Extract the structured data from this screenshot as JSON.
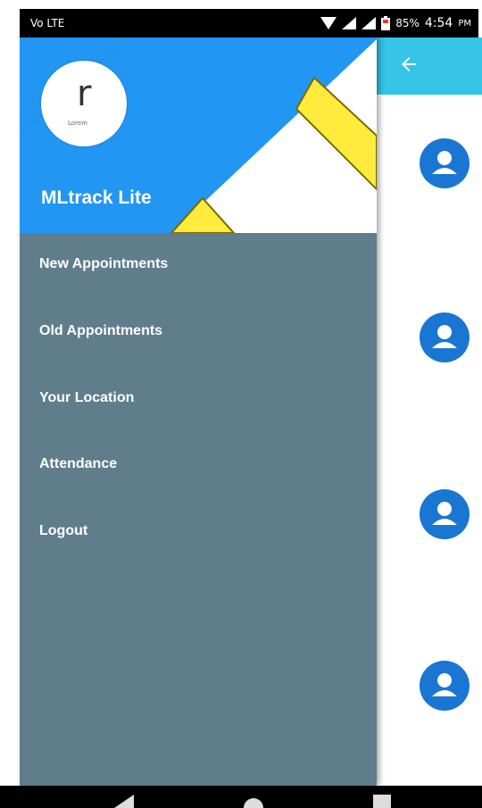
{
  "status_bar": {
    "left_text": "Vo LTE",
    "battery_percent": "85%",
    "time": "4:54",
    "ampm": "PM"
  },
  "drawer": {
    "logo_letter": "r",
    "logo_caption": "Lorem",
    "app_name": "MLtrack Lite",
    "menu_items": [
      {
        "label": "New Appointments"
      },
      {
        "label": "Old Appointments"
      },
      {
        "label": "Your Location"
      },
      {
        "label": "Attendance"
      },
      {
        "label": "Logout"
      }
    ]
  },
  "colors": {
    "drawer_bg": "#607d8b",
    "header_blue": "#2196f3",
    "header_yellow": "#ffeb3b",
    "appbar": "#35c3e8",
    "avatar": "#1976d2"
  },
  "icons": {
    "back": "arrow-left-icon",
    "avatar": "person-icon",
    "nav_back": "triangle-back-icon",
    "nav_home": "circle-home-icon",
    "nav_recent": "square-recent-icon"
  }
}
